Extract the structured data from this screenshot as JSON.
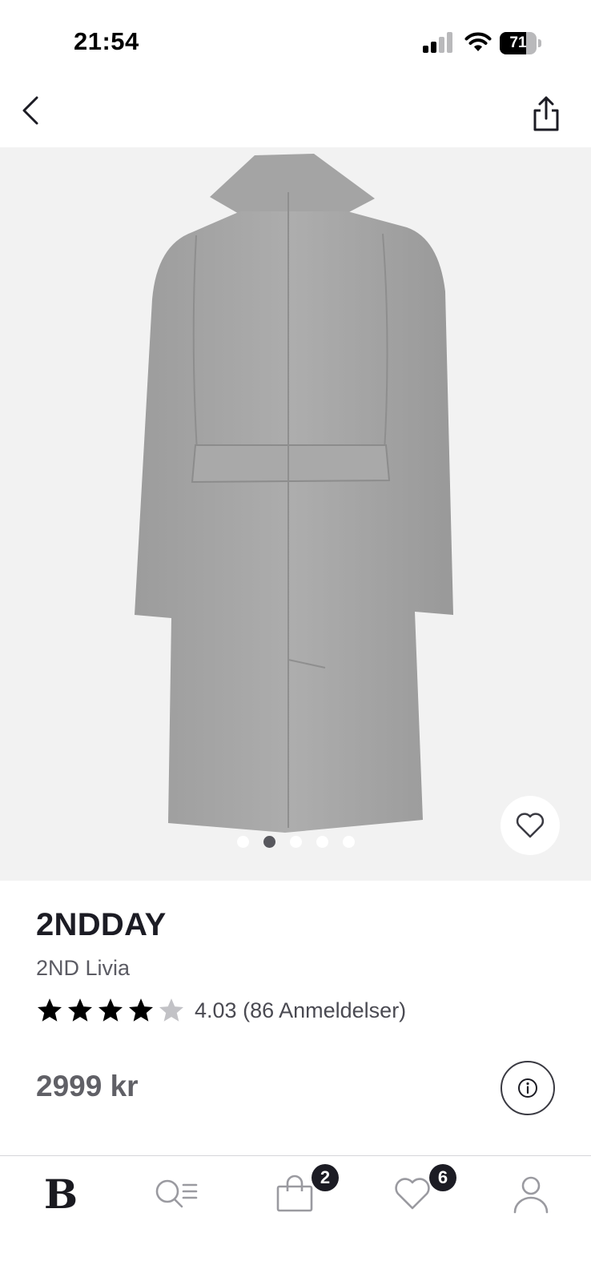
{
  "status_bar": {
    "time": "21:54",
    "battery": "71",
    "battery_level_percent": 71,
    "signal_bars": 2,
    "icons": [
      "cellular-signal-icon",
      "wifi-icon",
      "battery-icon"
    ]
  },
  "nav": {
    "icons": [
      "chevron-left-icon",
      "share-icon"
    ]
  },
  "gallery": {
    "image_count": 5,
    "active_index": 1,
    "wishlist_icon": "heart-outline-icon"
  },
  "product": {
    "brand": "2NDDAY",
    "name": "2ND Livia",
    "rating": "4.03",
    "rating_value": 4.03,
    "rating_max": 5,
    "reviews": "(86 Anmeldelser)",
    "price": "2999 kr",
    "info_icon": "info-icon"
  },
  "tab_bar": {
    "home_label": "B",
    "tabs": [
      {
        "icon": "logo-b-icon"
      },
      {
        "icon": "search-list-icon"
      },
      {
        "icon": "shopping-bag-icon",
        "badge": "2"
      },
      {
        "icon": "heart-icon",
        "badge": "6"
      },
      {
        "icon": "profile-icon"
      }
    ]
  },
  "colors": {
    "text_dark": "#1c1c24",
    "text_muted": "#5b5b63",
    "image_bg": "#f2f2f2",
    "star_filled": "#000000",
    "star_empty": "#c2c2c6",
    "badge_bg": "#1c1c24"
  }
}
